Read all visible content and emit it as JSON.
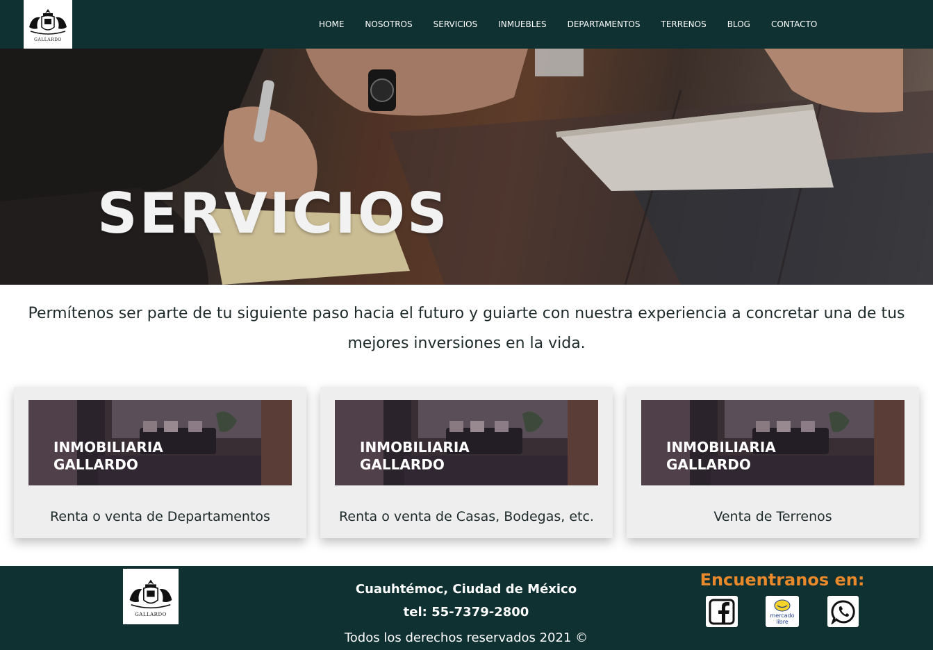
{
  "header": {
    "logo_alt": "GALLARDO",
    "nav": [
      "HOME",
      "NOSOTROS",
      "SERVICIOS",
      "INMUEBLES",
      "DEPARTAMENTOS",
      "TERRENOS",
      "BLOG",
      "CONTACTO"
    ]
  },
  "hero": {
    "title": "SERVICIOS"
  },
  "intro": {
    "text": "Permítenos ser parte de tu siguiente paso hacia el futuro y guiarte con nuestra experiencia a concretar una de tus mejores inversiones en la vida."
  },
  "cards": [
    {
      "image_label_line1": "INMOBILIARIA",
      "image_label_line2": "GALLARDO",
      "caption": "Renta o venta de Departamentos"
    },
    {
      "image_label_line1": "INMOBILIARIA",
      "image_label_line2": "GALLARDO",
      "caption": "Renta o venta de Casas, Bodegas, etc."
    },
    {
      "image_label_line1": "INMOBILIARIA",
      "image_label_line2": "GALLARDO",
      "caption": "Venta de Terrenos"
    }
  ],
  "footer": {
    "logo_alt": "GALLARDO",
    "address": "Cuauhtémoc, Ciudad de México",
    "phone": "tel: 55-7379-2800",
    "copyright": "Todos los derechos reservados 2021 ©",
    "find_us": "Encuentranos en:",
    "social": [
      {
        "name": "facebook",
        "icon": "facebook-icon"
      },
      {
        "name": "mercado-libre",
        "icon": "mercado-libre-icon",
        "text_line1": "mercado",
        "text_line2": "libre"
      },
      {
        "name": "whatsapp",
        "icon": "whatsapp-icon"
      }
    ]
  },
  "colors": {
    "header_bg": "#0f3131",
    "footer_bg": "#0f3131",
    "accent": "#e8892b",
    "card_bg": "#eeeeee"
  }
}
